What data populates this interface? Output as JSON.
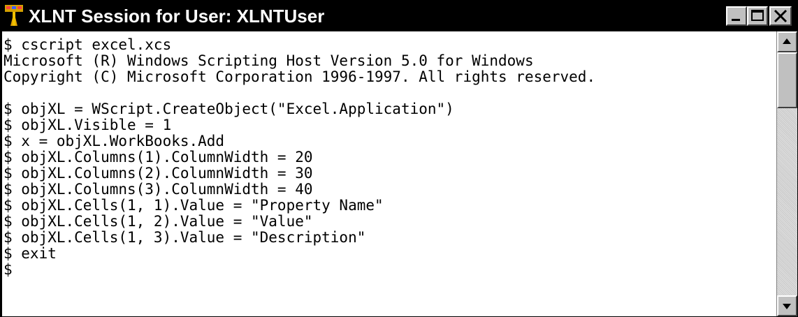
{
  "window": {
    "title": "XLNT Session for User: XLNTUser",
    "app_icon": "xlnt-app-icon",
    "controls": {
      "minimize_icon": "minimize-icon",
      "maximize_icon": "maximize-icon",
      "close_icon": "close-icon"
    }
  },
  "console": {
    "lines": [
      "$ cscript excel.xcs",
      "Microsoft (R) Windows Scripting Host Version 5.0 for Windows",
      "Copyright (C) Microsoft Corporation 1996-1997. All rights reserved.",
      "",
      "$ objXL = WScript.CreateObject(\"Excel.Application\")",
      "$ objXL.Visible = 1",
      "$ x = objXL.WorkBooks.Add",
      "$ objXL.Columns(1).ColumnWidth = 20",
      "$ objXL.Columns(2).ColumnWidth = 30",
      "$ objXL.Columns(3).ColumnWidth = 40",
      "$ objXL.Cells(1, 1).Value = \"Property Name\"",
      "$ objXL.Cells(1, 2).Value = \"Value\"",
      "$ objXL.Cells(1, 3).Value = \"Description\"",
      "$ exit",
      "$"
    ]
  },
  "scrollbar": {
    "up_icon": "scroll-up-arrow-icon",
    "down_icon": "scroll-down-arrow-icon"
  },
  "colors": {
    "titlebar_bg": "#000000",
    "titlebar_text": "#ffffff",
    "console_bg": "#ffffff",
    "console_text": "#000000",
    "chrome": "#c0c0c0"
  }
}
